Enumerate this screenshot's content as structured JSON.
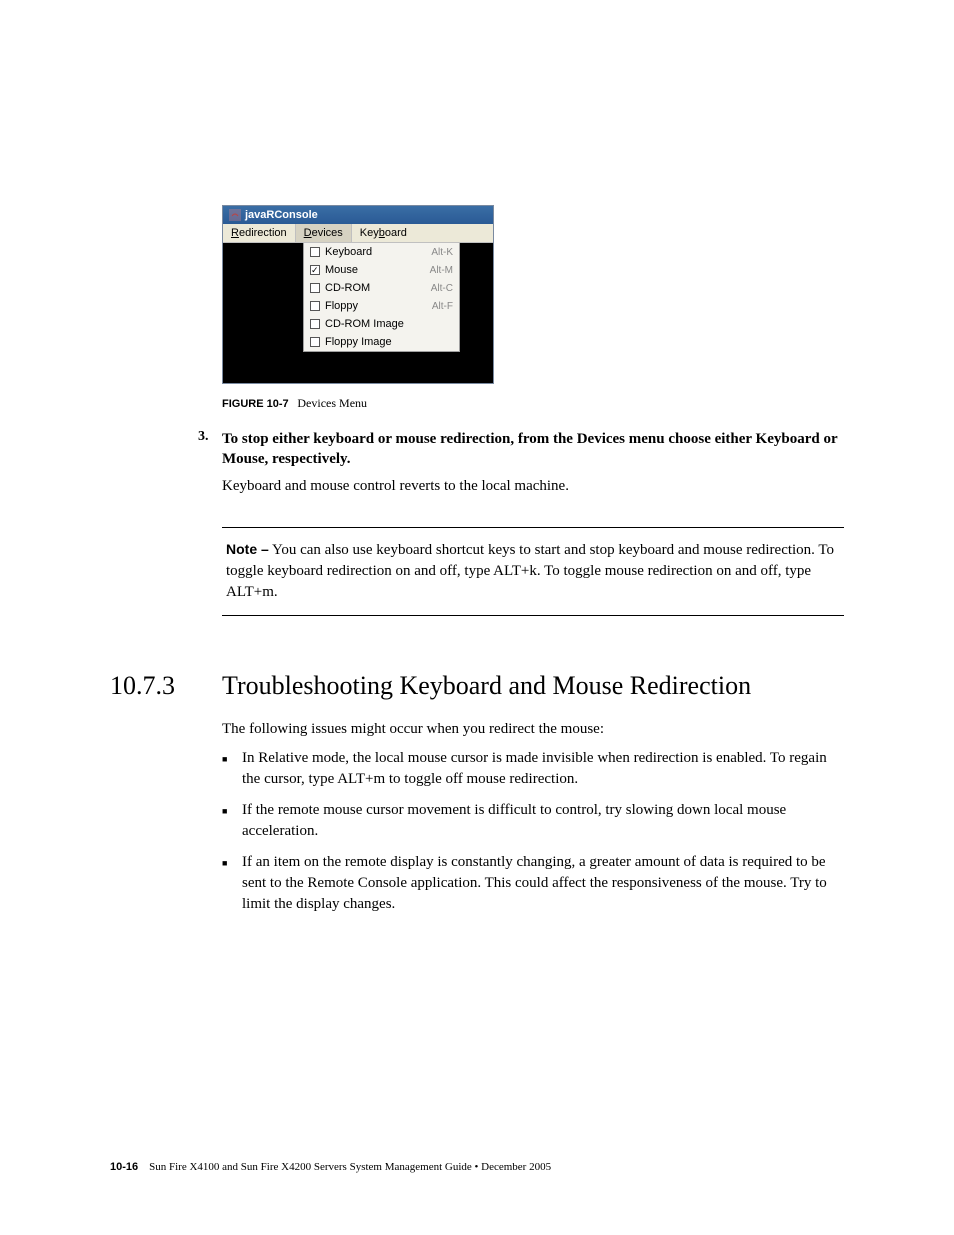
{
  "app": {
    "title": "javaRConsole",
    "menubar": [
      "Redirection",
      "Devices",
      "Keyboard"
    ],
    "dropdown": [
      {
        "label": "Keyboard",
        "sc": "Alt-K",
        "checked": false,
        "ul": "K"
      },
      {
        "label": "Mouse",
        "sc": "Alt-M",
        "checked": true,
        "ul": "M"
      },
      {
        "label": "CD-ROM",
        "sc": "Alt-C",
        "checked": false,
        "ul": "C"
      },
      {
        "label": "Floppy",
        "sc": "Alt-F",
        "checked": false,
        "ul": "F"
      },
      {
        "label": "CD-ROM Image",
        "sc": "",
        "checked": false,
        "ul": "I"
      },
      {
        "label": "Floppy Image",
        "sc": "",
        "checked": false,
        "ul": "F"
      }
    ]
  },
  "figure": {
    "label": "FIGURE 10-7",
    "caption": "Devices Menu"
  },
  "step": {
    "num": "3.",
    "title": "To stop either keyboard or mouse redirection, from the Devices menu choose either Keyboard or Mouse, respectively.",
    "body": "Keyboard and mouse control reverts to the local machine."
  },
  "note": {
    "label": "Note –",
    "body": "You can also use keyboard shortcut keys to start and stop keyboard and mouse redirection. To toggle keyboard redirection on and off, type ALT+k. To toggle mouse redirection on and off, type ALT+m."
  },
  "section": {
    "num": "10.7.3",
    "title": "Troubleshooting Keyboard and Mouse Redirection"
  },
  "intro": "The following issues might occur when you redirect the mouse:",
  "bullets": [
    "In Relative mode, the local mouse cursor is made invisible when redirection is enabled. To regain the cursor, type ALT+m to toggle off mouse redirection.",
    "If the remote mouse cursor movement is difficult to control, try slowing down local mouse acceleration.",
    "If an item on the remote display is constantly changing, a greater amount of data is required to be sent to the Remote Console application. This could affect the responsiveness of the mouse. Try to limit the display changes."
  ],
  "footer": {
    "page": "10-16",
    "text": "Sun Fire X4100 and Sun Fire X4200 Servers System Management Guide • December 2005"
  }
}
